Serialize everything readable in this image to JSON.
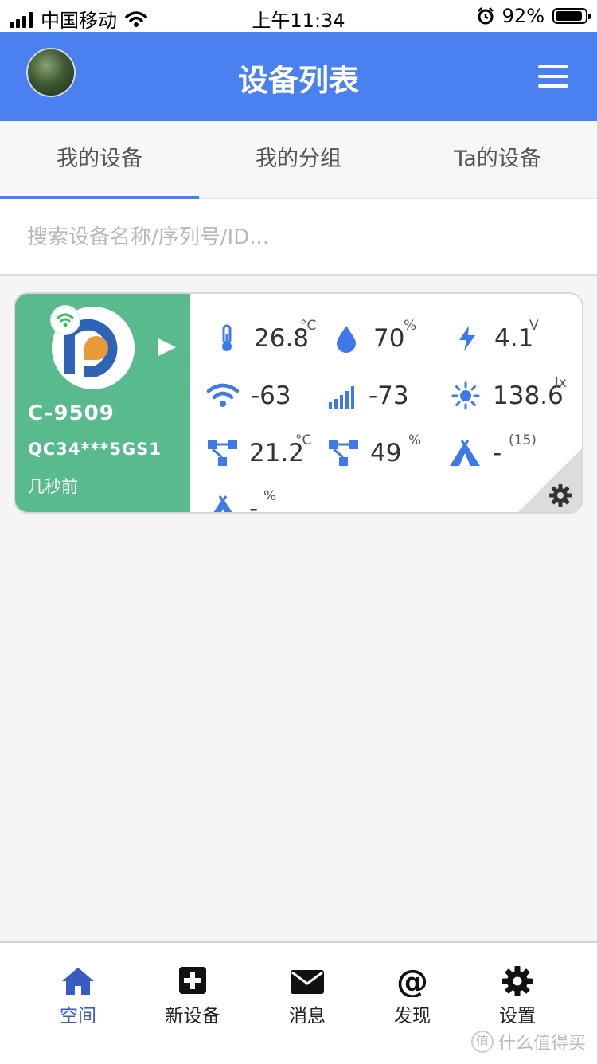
{
  "status_bar": {
    "carrier": "中国移动",
    "time": "上午11:34",
    "battery": "92%",
    "battery_level": 0.92
  },
  "header": {
    "title": "设备列表",
    "menu_icon": "hamburger-icon"
  },
  "tabs": [
    {
      "label": "我的设备",
      "active": true
    },
    {
      "label": "我的分组",
      "active": false
    },
    {
      "label": "Ta的设备",
      "active": false
    }
  ],
  "search": {
    "placeholder": "搜索设备名称/序列号/ID...",
    "value": ""
  },
  "device": {
    "name": "C-9509",
    "serial": "QC34***5GS1",
    "updated": "几秒前",
    "metrics": [
      {
        "icon": "thermometer-icon",
        "value": "26.8",
        "unit": "°C"
      },
      {
        "icon": "humidity-drop-icon",
        "value": "70",
        "unit": "%"
      },
      {
        "icon": "lightning-icon",
        "value": "4.1",
        "unit": "V"
      },
      {
        "icon": "wifi-icon",
        "value": "-63",
        "unit": ""
      },
      {
        "icon": "signal-bars-icon",
        "value": "-73",
        "unit": ""
      },
      {
        "icon": "sun-icon",
        "value": "138.6",
        "unit": "lx"
      },
      {
        "icon": "network-probe-icon",
        "value": "21.2",
        "unit": "°C"
      },
      {
        "icon": "network-probe-icon",
        "value": "49",
        "unit": "%"
      },
      {
        "icon": "tent-icon",
        "value": "-",
        "unit": "(15)"
      },
      {
        "icon": "tent-icon",
        "value": "-",
        "unit": "%"
      }
    ]
  },
  "nav": [
    {
      "label": "空间",
      "icon": "home-icon",
      "active": true
    },
    {
      "label": "新设备",
      "icon": "plus-square-icon",
      "active": false
    },
    {
      "label": "消息",
      "icon": "envelope-icon",
      "active": false
    },
    {
      "label": "发现",
      "icon": "at-icon",
      "active": false
    },
    {
      "label": "设置",
      "icon": "gear-icon",
      "active": false
    }
  ],
  "watermark": "什么值得买",
  "colors": {
    "primary": "#4a80f0",
    "card_side": "#58ba8d",
    "metric_icon": "#3f78e8",
    "nav_active": "#3b5bc4"
  }
}
